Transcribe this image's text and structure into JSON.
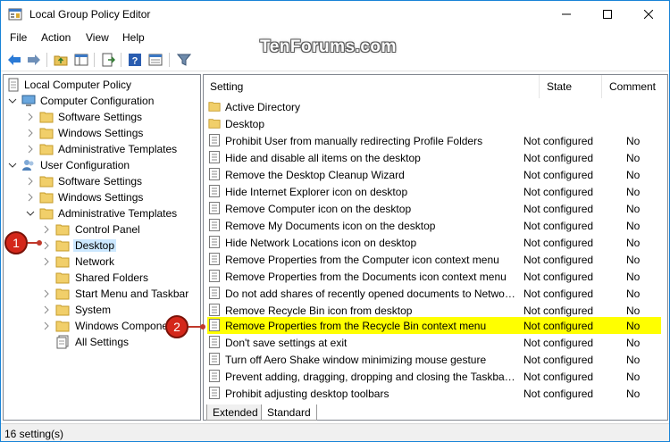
{
  "window": {
    "title": "Local Group Policy Editor"
  },
  "menu": [
    "File",
    "Action",
    "View",
    "Help"
  ],
  "watermark": "TenForums.com",
  "tree": {
    "root": "Local Computer Policy",
    "computer_config": "Computer Configuration",
    "cc_children": [
      "Software Settings",
      "Windows Settings",
      "Administrative Templates"
    ],
    "user_config": "User Configuration",
    "uc_children": [
      "Software Settings",
      "Windows Settings",
      "Administrative Templates"
    ],
    "admin_children": [
      "Control Panel",
      "Desktop",
      "Network",
      "Shared Folders",
      "Start Menu and Taskbar",
      "System",
      "Windows Compone",
      "All Settings"
    ]
  },
  "columns": {
    "setting": "Setting",
    "state": "State",
    "comment": "Comment"
  },
  "folders": [
    "Active Directory",
    "Desktop"
  ],
  "settings": [
    {
      "name": "Prohibit User from manually redirecting Profile Folders",
      "state": "Not configured",
      "comment": "No"
    },
    {
      "name": "Hide and disable all items on the desktop",
      "state": "Not configured",
      "comment": "No"
    },
    {
      "name": "Remove the Desktop Cleanup Wizard",
      "state": "Not configured",
      "comment": "No"
    },
    {
      "name": "Hide Internet Explorer icon on desktop",
      "state": "Not configured",
      "comment": "No"
    },
    {
      "name": "Remove Computer icon on the desktop",
      "state": "Not configured",
      "comment": "No"
    },
    {
      "name": "Remove My Documents icon on the desktop",
      "state": "Not configured",
      "comment": "No"
    },
    {
      "name": "Hide Network Locations icon on desktop",
      "state": "Not configured",
      "comment": "No"
    },
    {
      "name": "Remove Properties from the Computer icon context menu",
      "state": "Not configured",
      "comment": "No"
    },
    {
      "name": "Remove Properties from the Documents icon context menu",
      "state": "Not configured",
      "comment": "No"
    },
    {
      "name": "Do not add shares of recently opened documents to Network Locations",
      "state": "Not configured",
      "comment": "No"
    },
    {
      "name": "Remove Recycle Bin icon from desktop",
      "state": "Not configured",
      "comment": "No"
    },
    {
      "name": "Remove Properties from the Recycle Bin context menu",
      "state": "Not configured",
      "comment": "No"
    },
    {
      "name": "Don't save settings at exit",
      "state": "Not configured",
      "comment": "No"
    },
    {
      "name": "Turn off Aero Shake window minimizing mouse gesture",
      "state": "Not configured",
      "comment": "No"
    },
    {
      "name": "Prevent adding, dragging, dropping and closing the Taskbar's toolbars",
      "state": "Not configured",
      "comment": "No"
    },
    {
      "name": "Prohibit adjusting desktop toolbars",
      "state": "Not configured",
      "comment": "No"
    }
  ],
  "tabs": [
    "Extended",
    "Standard"
  ],
  "status": "16 setting(s)",
  "callouts": [
    "1",
    "2"
  ],
  "colors": {
    "highlight": "#ffff00",
    "callout": "#d4271a",
    "selection": "#cce8ff"
  }
}
